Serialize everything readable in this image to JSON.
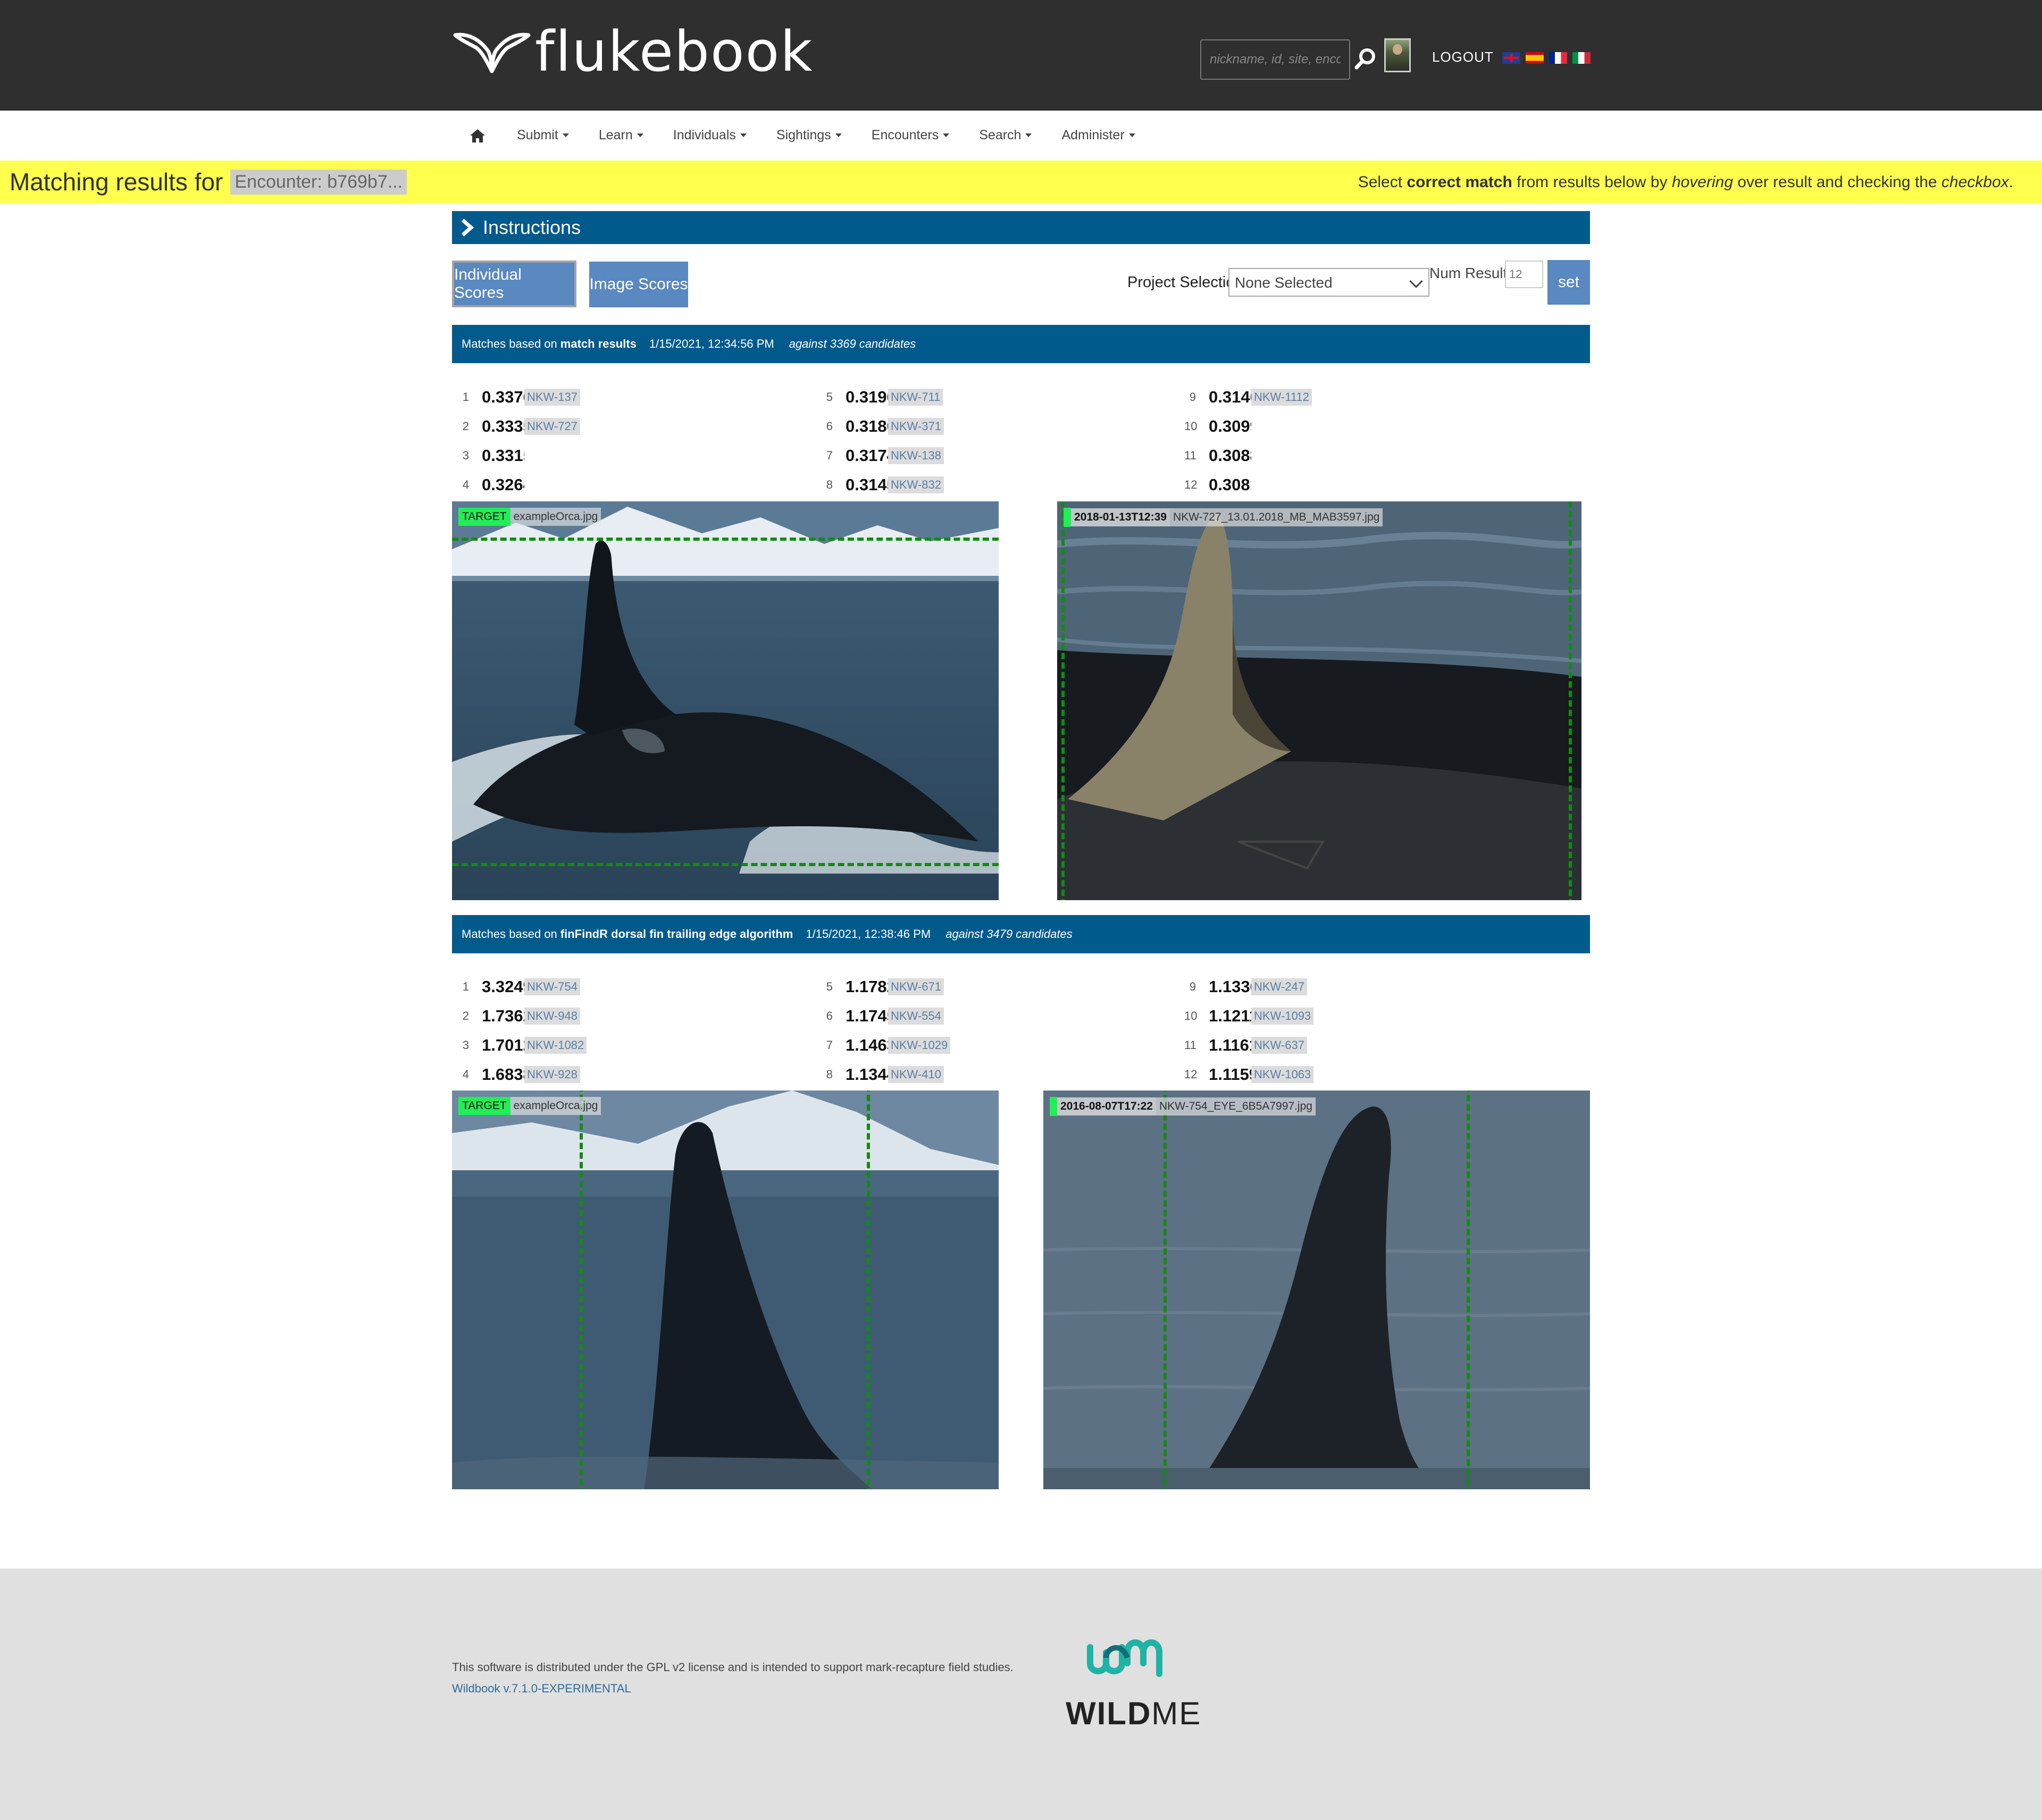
{
  "header": {
    "logo_text": "flukebook",
    "search_placeholder": "nickname, id, site, encounter nu",
    "logout_label": "LOGOUT",
    "languages": [
      "en",
      "es",
      "fr",
      "it"
    ]
  },
  "nav": {
    "items": [
      "Submit",
      "Learn",
      "Individuals",
      "Sightings",
      "Encounters",
      "Search",
      "Administer"
    ]
  },
  "banner": {
    "title": "Matching results for",
    "encounter_badge": "Encounter: b769b7...",
    "instr_pre": "Select ",
    "instr_bold": "correct match",
    "instr_mid": " from results below by ",
    "instr_hover": "hovering",
    "instr_mid2": " over result and checking the ",
    "instr_checkbox": "checkbox",
    "instr_end": "."
  },
  "instructions_label": "Instructions",
  "controls": {
    "individual_scores": "Individual Scores",
    "image_scores": "Image Scores",
    "project_label": "Project Selection",
    "project_value": "None Selected",
    "num_results_label": "Num Results:",
    "num_results_value": "12",
    "set_label": "set"
  },
  "sections": [
    {
      "prefix": "Matches based on",
      "algorithm": "match results",
      "datetime": "1/15/2021, 12:34:56 PM",
      "candidates": "against 3369 candidates",
      "results": [
        {
          "rank": "1",
          "score": "0.3376",
          "id": "NKW-137"
        },
        {
          "rank": "2",
          "score": "0.3335",
          "id": "NKW-727"
        },
        {
          "rank": "3",
          "score": "0.3315",
          "id": ""
        },
        {
          "rank": "4",
          "score": "0.3264",
          "id": ""
        },
        {
          "rank": "5",
          "score": "0.3196",
          "id": "NKW-711"
        },
        {
          "rank": "6",
          "score": "0.3180",
          "id": "NKW-371"
        },
        {
          "rank": "7",
          "score": "0.3174",
          "id": "NKW-138"
        },
        {
          "rank": "8",
          "score": "0.3145",
          "id": "NKW-832"
        },
        {
          "rank": "9",
          "score": "0.3140",
          "id": "NKW-1112"
        },
        {
          "rank": "10",
          "score": "0.3099",
          "id": ""
        },
        {
          "rank": "11",
          "score": "0.3088",
          "id": ""
        },
        {
          "rank": "12",
          "score": "0.3081",
          "id": ""
        }
      ],
      "target_tag": "TARGET",
      "target_file": "exampleOrca.jpg",
      "match_date": "2018-01-13T12:39",
      "match_file": "NKW-727_13.01.2018_MB_MAB3597.jpg"
    },
    {
      "prefix": "Matches based on",
      "algorithm": "finFindR dorsal fin trailing edge algorithm",
      "datetime": "1/15/2021, 12:38:46 PM",
      "candidates": "against 3479 candidates",
      "results": [
        {
          "rank": "1",
          "score": "3.3249",
          "id": "NKW-754"
        },
        {
          "rank": "2",
          "score": "1.7362",
          "id": "NKW-948"
        },
        {
          "rank": "3",
          "score": "1.7012",
          "id": "NKW-1082"
        },
        {
          "rank": "4",
          "score": "1.6838",
          "id": "NKW-928"
        },
        {
          "rank": "5",
          "score": "1.1782",
          "id": "NKW-671"
        },
        {
          "rank": "6",
          "score": "1.1745",
          "id": "NKW-554"
        },
        {
          "rank": "7",
          "score": "1.1463",
          "id": "NKW-1029"
        },
        {
          "rank": "8",
          "score": "1.1344",
          "id": "NKW-410"
        },
        {
          "rank": "9",
          "score": "1.1336",
          "id": "NKW-247"
        },
        {
          "rank": "10",
          "score": "1.1211",
          "id": "NKW-1093"
        },
        {
          "rank": "11",
          "score": "1.1161",
          "id": "NKW-637"
        },
        {
          "rank": "12",
          "score": "1.1159",
          "id": "NKW-1063"
        }
      ],
      "target_tag": "TARGET",
      "target_file": "exampleOrca.jpg",
      "match_date": "2016-08-07T17:22",
      "match_file": "NKW-754_EYE_6B5A7997.jpg"
    }
  ],
  "footer": {
    "license": "This software is distributed under the GPL v2 license and is intended to support mark-recapture field studies.",
    "version_link": "Wildbook v.7.1.0-EXPERIMENTAL",
    "brand_bold": "WILD",
    "brand_light": "ME"
  },
  "colors": {
    "header_bg": "#2f2f2f",
    "accent_blue": "#005a8c",
    "button_blue": "#5a88c0",
    "banner_yellow": "#ffff4d",
    "target_green": "#22ee55",
    "bbox_green": "#138a13",
    "footer_bg": "#e0e0e0",
    "wildme_teal": "#1fb3a5"
  }
}
